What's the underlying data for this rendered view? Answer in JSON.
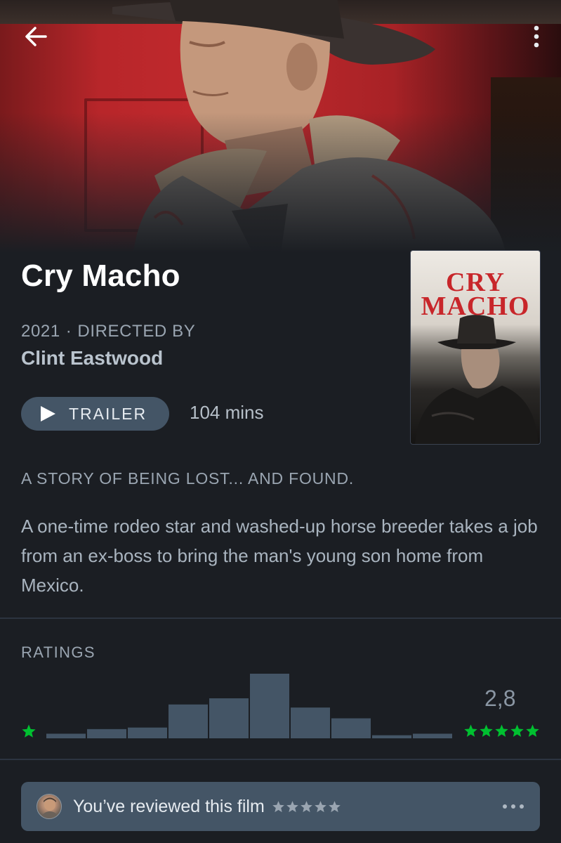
{
  "film": {
    "title": "Cry Macho",
    "year": "2021",
    "directed_by_label": "DIRECTED BY",
    "director": "Clint Eastwood",
    "runtime": "104 mins",
    "tagline": "A STORY OF BEING LOST... AND FOUND.",
    "synopsis": "A one-time rodeo star and washed-up horse breeder takes a job from an ex-boss to bring the man's young son home from Mexico.",
    "poster_title_line1": "CRY",
    "poster_title_line2": "MACHO"
  },
  "actions": {
    "trailer_label": "TRAILER",
    "back_icon": "arrow-left-icon",
    "more_icon": "more-vertical-icon"
  },
  "ratings": {
    "label": "RATINGS",
    "average": "2,8",
    "max_stars": 5,
    "distribution": [
      3,
      6,
      7,
      22,
      26,
      42,
      20,
      13,
      2,
      3
    ]
  },
  "review": {
    "text": "You’ve reviewed this film",
    "stars": 5
  },
  "colors": {
    "background": "#1b1e23",
    "accent_green": "#00c030",
    "bar": "#445566",
    "poster_red": "#c8262a"
  }
}
